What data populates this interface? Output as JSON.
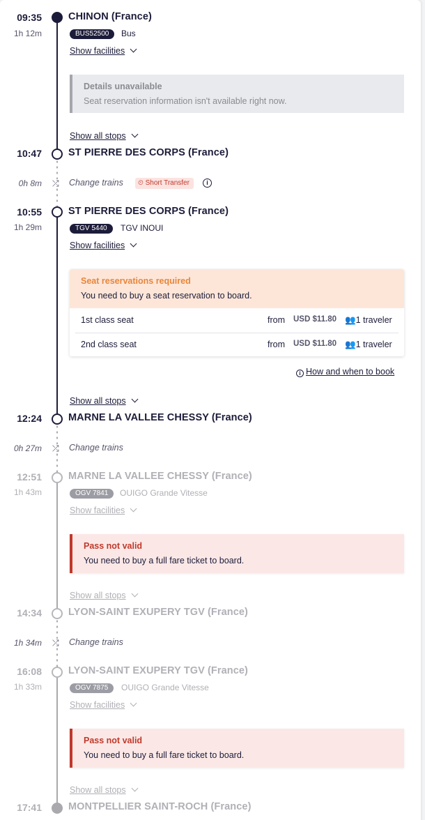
{
  "segments": [
    {
      "dep_time": "09:35",
      "duration": "1h 12m",
      "from": "CHINON (France)",
      "badge": "BUS52500",
      "service": "Bus"
    },
    {
      "dep_time": "10:55",
      "duration": "1h 29m",
      "from": "ST PIERRE DES CORPS (France)",
      "badge": "TGV 5440",
      "service": "TGV INOUI"
    },
    {
      "dep_time": "12:51",
      "duration": "1h 43m",
      "from": "MARNE LA VALLEE CHESSY (France)",
      "badge": "OGV 7841",
      "service": "OUIGO Grande Vitesse"
    },
    {
      "dep_time": "16:08",
      "duration": "1h 33m",
      "from": "LYON-SAINT EXUPERY TGV (France)",
      "badge": "OGV 7875",
      "service": "OUIGO Grande Vitesse"
    }
  ],
  "arrivals": [
    {
      "time": "10:47",
      "station": "ST PIERRE DES CORPS (France)"
    },
    {
      "time": "12:24",
      "station": "MARNE LA VALLEE CHESSY (France)"
    },
    {
      "time": "14:34",
      "station": "LYON-SAINT EXUPERY TGV (France)"
    },
    {
      "time": "17:41",
      "station": "MONTPELLIER SAINT-ROCH (France)"
    }
  ],
  "changes": [
    {
      "duration": "0h 8m",
      "label": "Change trains",
      "tag": "Short Transfer"
    },
    {
      "duration": "0h 27m",
      "label": "Change trains"
    },
    {
      "duration": "1h 34m",
      "label": "Change trains"
    }
  ],
  "links": {
    "facilities": "Show facilities",
    "stops": "Show all stops",
    "how_book": "How and when to book"
  },
  "notices": {
    "unavailable": {
      "title": "Details unavailable",
      "body": "Seat reservation information isn't available right now."
    },
    "required": {
      "title": "Seat reservations required",
      "body": "You need to buy a seat reservation to board."
    },
    "invalid": {
      "title": "Pass not valid",
      "body": "You need to buy a full fare ticket to board."
    }
  },
  "reservations": [
    {
      "class": "1st class seat",
      "from": "from",
      "price": "USD $11.80",
      "travelers": "1 traveler"
    },
    {
      "class": "2nd class seat",
      "from": "from",
      "price": "USD $11.80",
      "travelers": "1 traveler"
    }
  ],
  "icons": {
    "change": "shuffle-icon",
    "traveler": "people-icon",
    "info": "info-icon",
    "chevron": "chevron-down-icon"
  },
  "colors": {
    "navy": "#1c1c3a",
    "short_transfer": "#c0392b",
    "reservation_accent": "#e8863a",
    "invalid_accent": "#c0392b"
  }
}
